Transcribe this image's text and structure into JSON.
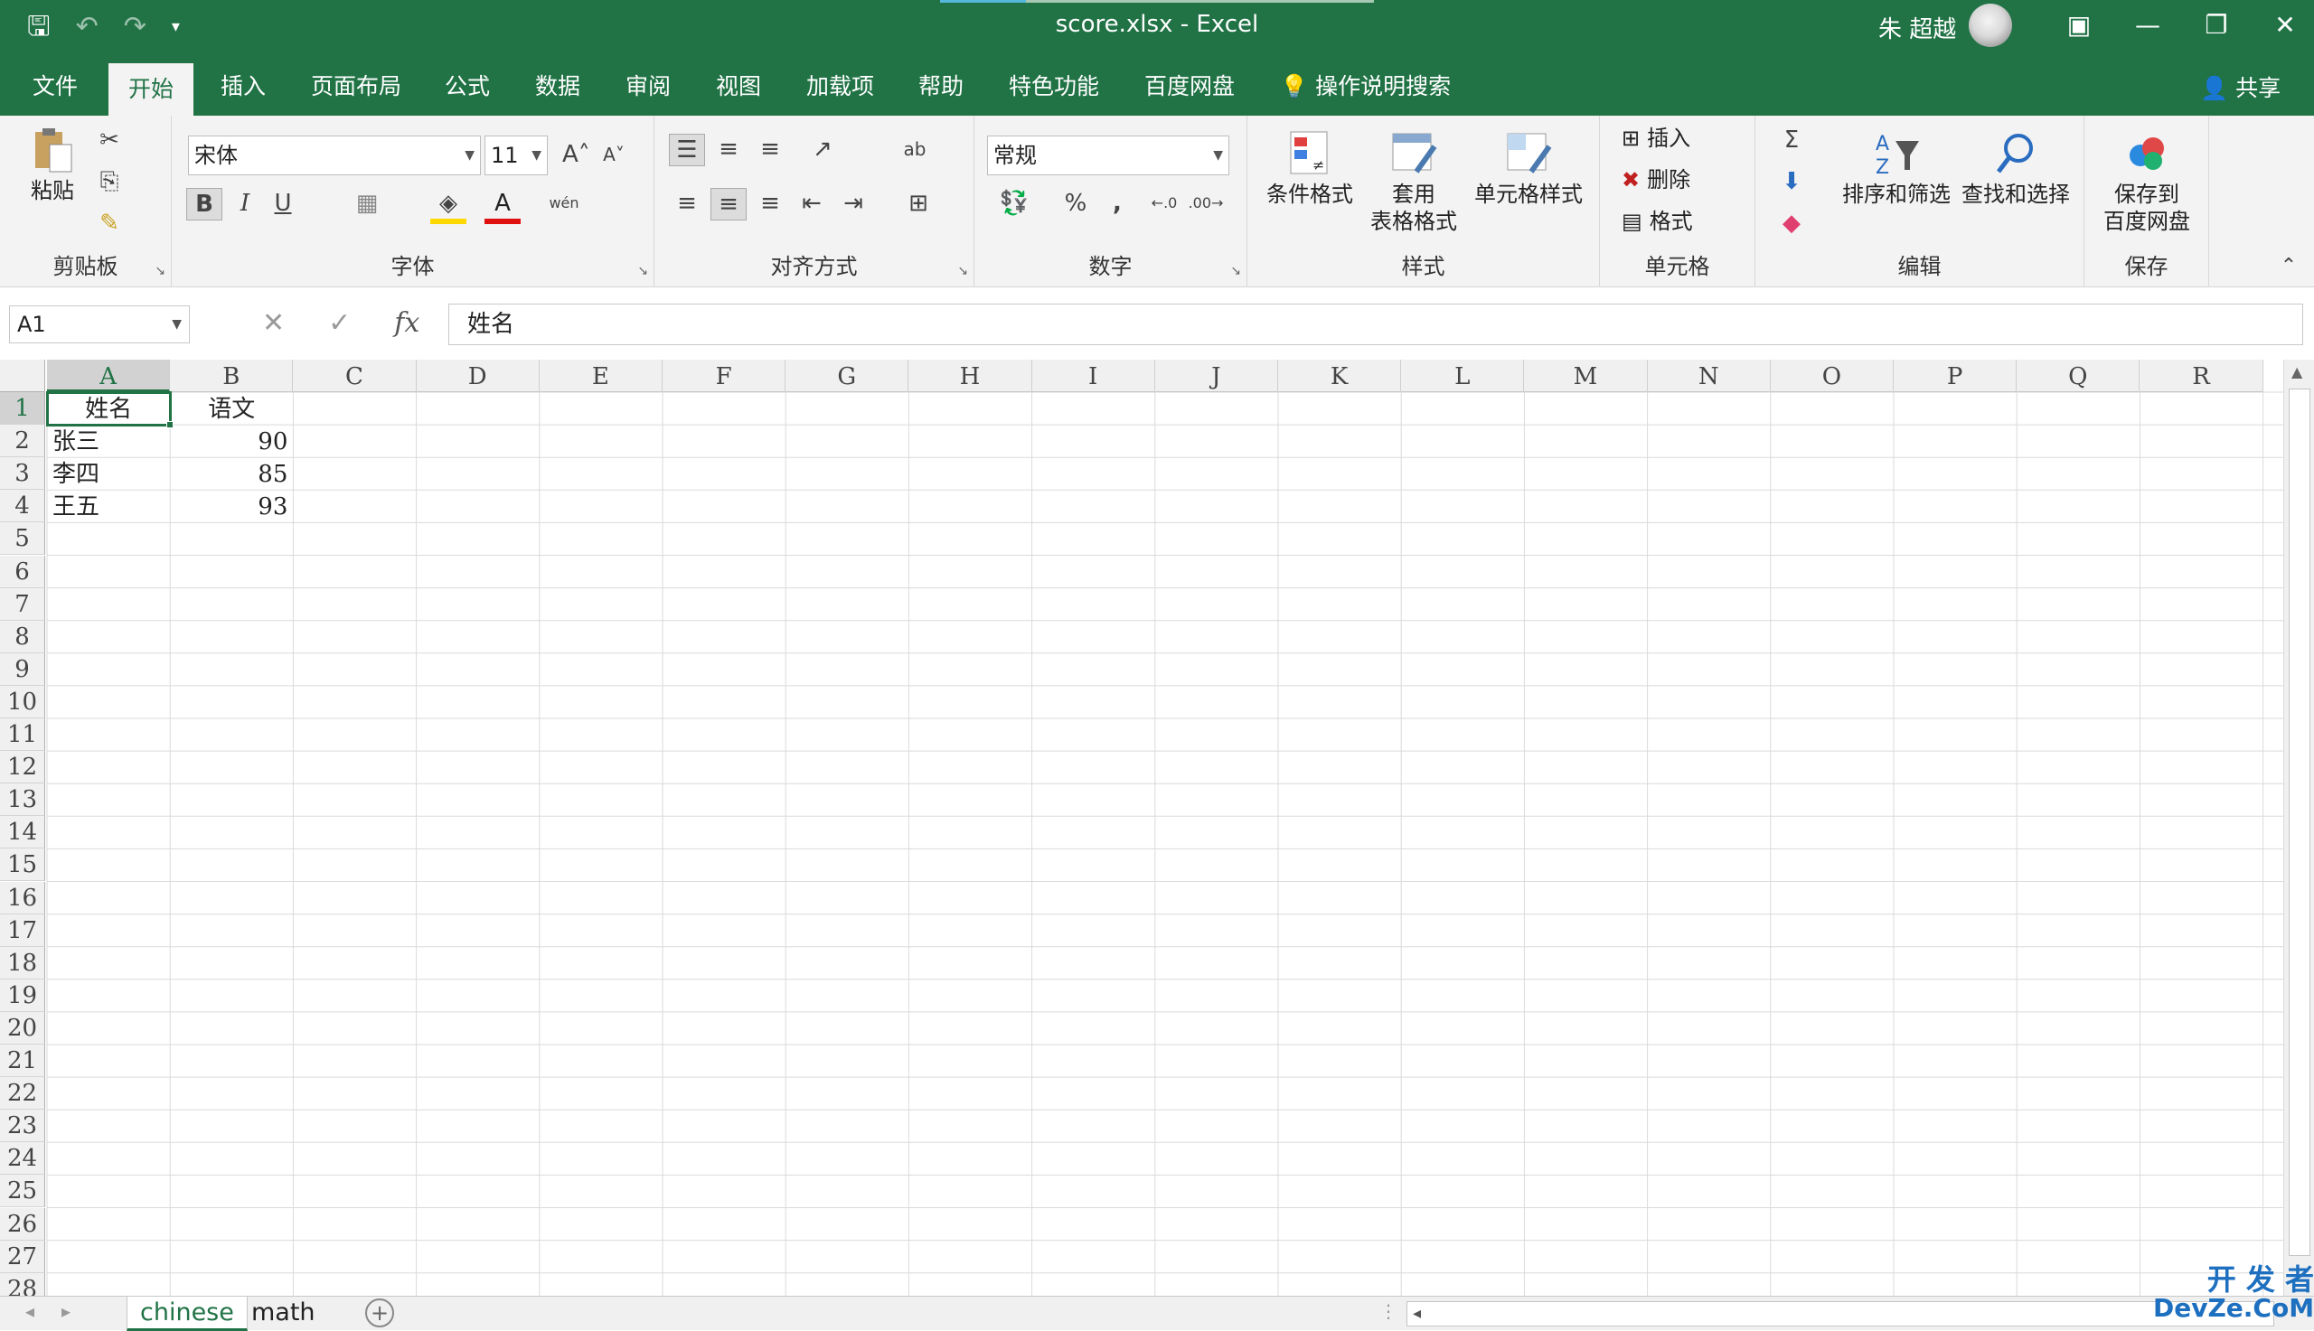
{
  "titlebar": {
    "title": "score.xlsx  -  Excel",
    "user": "朱 超越"
  },
  "menu": {
    "tabs": [
      "文件",
      "开始",
      "插入",
      "页面布局",
      "公式",
      "数据",
      "审阅",
      "视图",
      "加载项",
      "帮助",
      "特色功能",
      "百度网盘"
    ],
    "active": "开始",
    "search": "操作说明搜索",
    "share": "共享"
  },
  "ribbon": {
    "clipboard": {
      "label": "剪贴板",
      "paste": "粘贴"
    },
    "font": {
      "label": "字体",
      "name": "宋体",
      "size": "11",
      "bold": "B",
      "italic": "I",
      "underline": "U",
      "font_color": "A",
      "phonetic": "wén"
    },
    "alignment": {
      "label": "对齐方式"
    },
    "number": {
      "label": "数字",
      "format": "常规",
      "percent": "%",
      "comma": ","
    },
    "styles": {
      "label": "样式",
      "conditional": "条件格式",
      "table_line1": "套用",
      "table_line2": "表格格式",
      "cell_styles": "单元格样式"
    },
    "cells": {
      "label": "单元格",
      "insert": "插入",
      "delete": "删除",
      "format": "格式"
    },
    "editing": {
      "label": "编辑",
      "sort": "排序和筛选",
      "find": "查找和选择"
    },
    "save": {
      "label": "保存",
      "line1": "保存到",
      "line2": "百度网盘"
    }
  },
  "formula_bar": {
    "name_box": "A1",
    "content": "姓名",
    "fx": "fx"
  },
  "sheet": {
    "columns": [
      "A",
      "B",
      "C",
      "D",
      "E",
      "F",
      "G",
      "H",
      "I",
      "J",
      "K",
      "L",
      "M",
      "N",
      "O",
      "P",
      "Q",
      "R"
    ],
    "rows": [
      "1",
      "2",
      "3",
      "4",
      "5",
      "6",
      "7",
      "8",
      "9",
      "10",
      "11",
      "12",
      "13",
      "14",
      "15",
      "16",
      "17",
      "18",
      "19",
      "20",
      "21",
      "22",
      "23",
      "24",
      "25",
      "26",
      "27",
      "28"
    ],
    "cells": [
      [
        "姓名",
        "语文"
      ],
      [
        "张三",
        "90"
      ],
      [
        "李四",
        "85"
      ],
      [
        "王五",
        "93"
      ]
    ],
    "selected": "A1"
  },
  "tabs": {
    "sheets": [
      "chinese",
      "math"
    ],
    "active": "chinese"
  },
  "watermark": {
    "line1": "开 发 者",
    "line2": "DevZe.CoM"
  },
  "colors": {
    "accent": "#217346",
    "ribbon_bg": "#f3f3f3"
  }
}
